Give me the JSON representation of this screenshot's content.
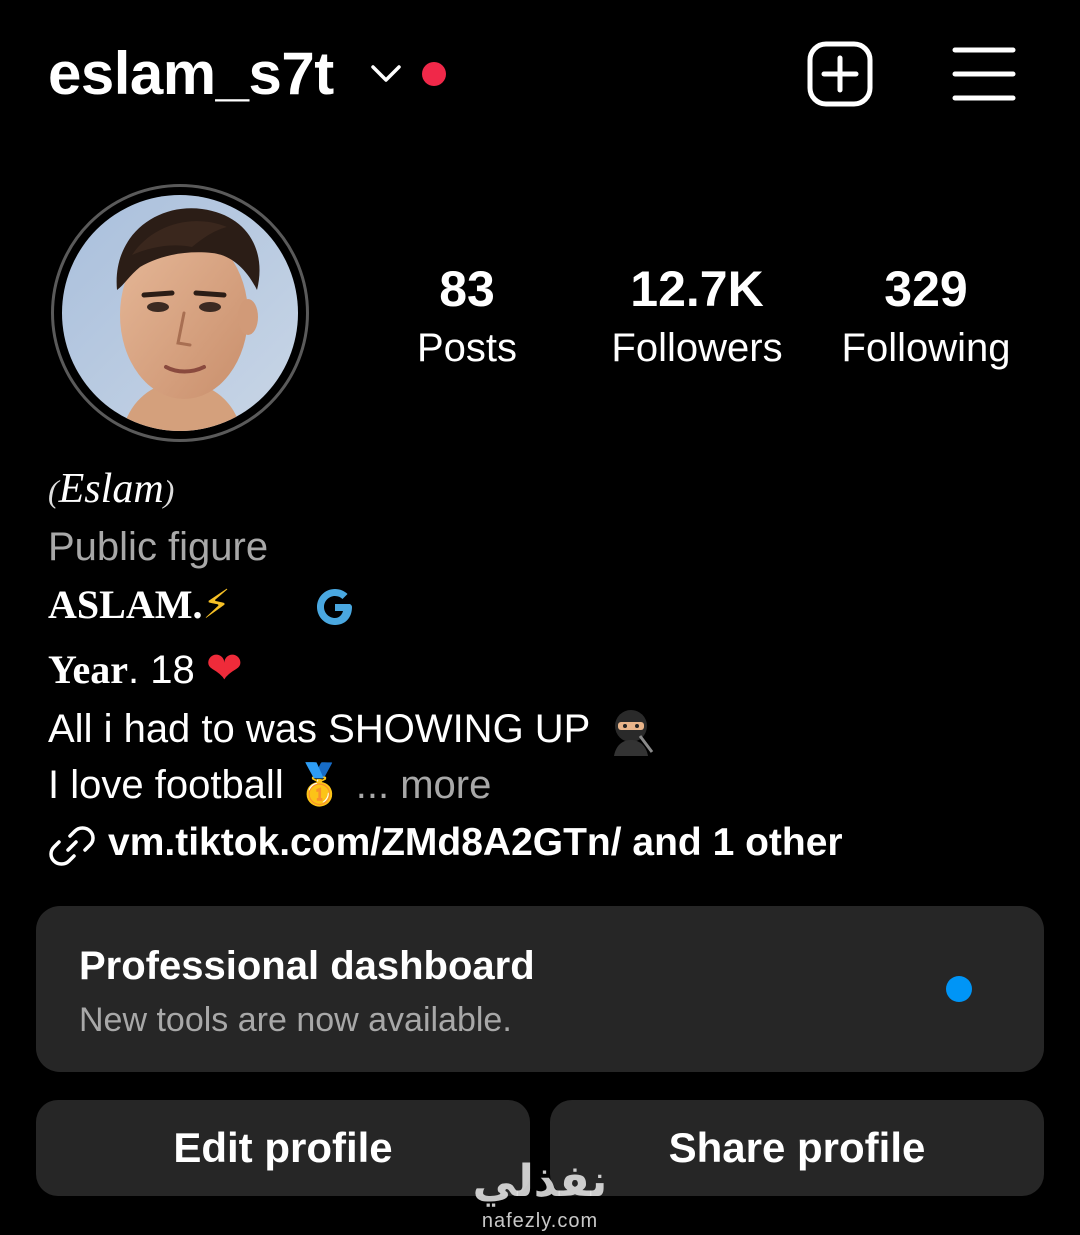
{
  "header": {
    "username": "eslam_s7t",
    "icons": {
      "account_switcher": "chevron-down-icon",
      "notification": "red-dot",
      "new_post": "plus-square-icon",
      "menu": "hamburger-menu-icon"
    }
  },
  "stats": {
    "posts": {
      "value": "83",
      "label": "Posts"
    },
    "followers": {
      "value": "12.7K",
      "label": "Followers"
    },
    "following": {
      "value": "329",
      "label": "Following"
    }
  },
  "bio": {
    "display_name": "Eslam",
    "category": "Public figure",
    "line1": "ASLAM.",
    "line1_emoji": "⚡",
    "line2_word": "Year",
    "line2_rest": ". 18",
    "line2_emoji": "❤",
    "line3": "All i had to was SHOWING UP",
    "line4": "I love football",
    "line4_emoji": "🥇",
    "more_label": "... more",
    "link_text": "vm.tiktok.com/ZMd8A2GTn/ and 1 other"
  },
  "dashboard": {
    "title": "Professional dashboard",
    "subtitle": "New tools are now available."
  },
  "buttons": {
    "edit_profile": "Edit profile",
    "share_profile": "Share profile"
  },
  "watermark": {
    "arabic": "نفذلي",
    "url": "nafezly.com"
  },
  "colors": {
    "background": "#000000",
    "card": "#262626",
    "secondary_text": "#a8a8a8",
    "notification_red": "#f02849",
    "accent_blue": "#0095f6"
  }
}
